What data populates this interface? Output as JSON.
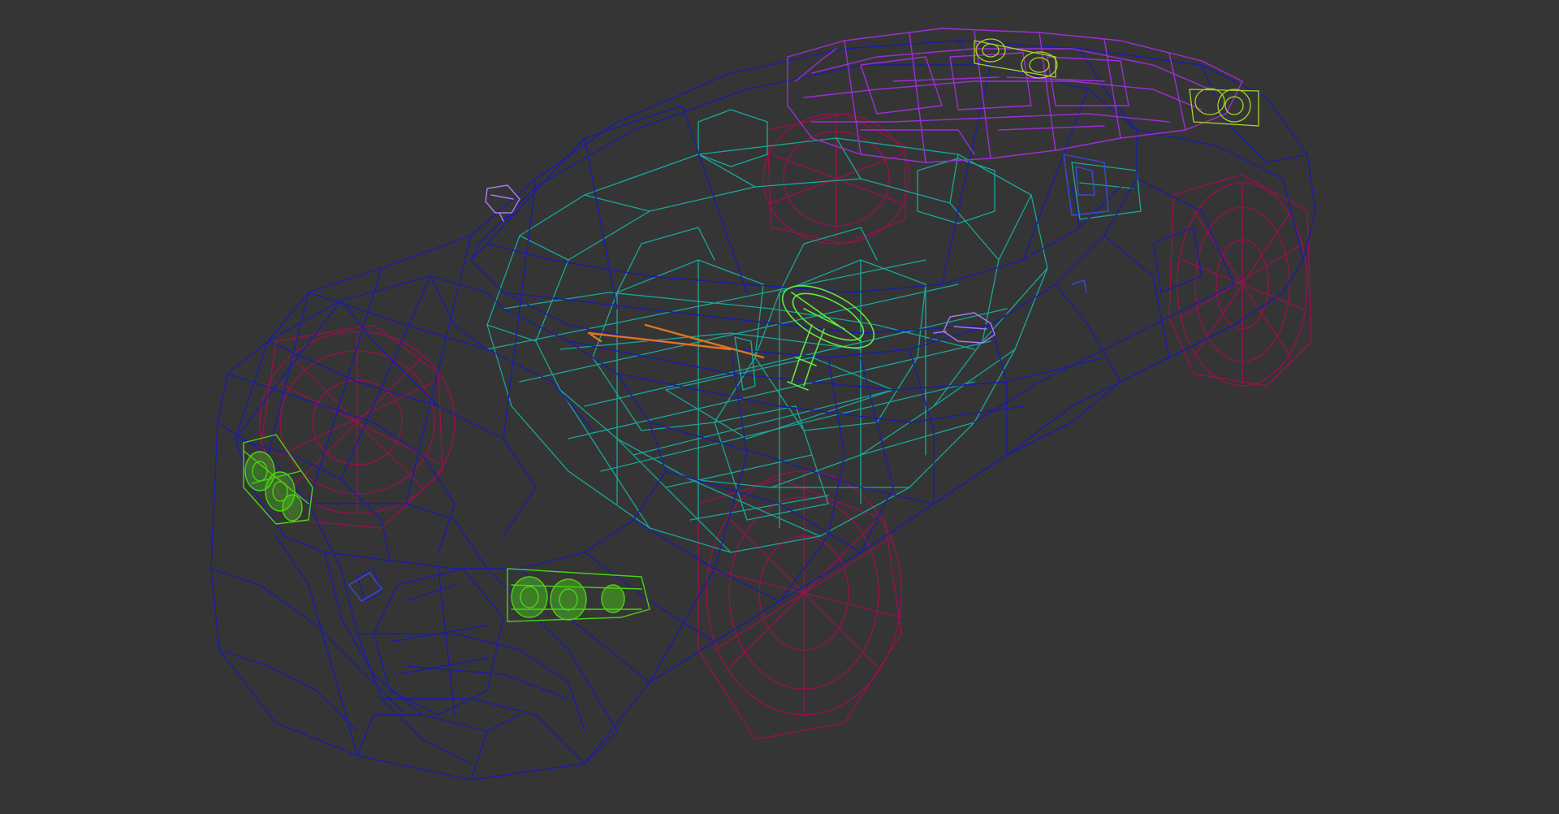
{
  "viewport": {
    "background": "#353535",
    "render_mode": "wireframe"
  },
  "model": {
    "subject": "sports car",
    "parts": [
      {
        "name": "body-shell",
        "color": "#1c1ca8"
      },
      {
        "name": "wheels",
        "color": "#9c0f4e"
      },
      {
        "name": "interior",
        "color": "#19a89a"
      },
      {
        "name": "rear-deck",
        "color": "#9c2fd6"
      },
      {
        "name": "head-lights",
        "color": "#4ad414"
      },
      {
        "name": "tail-lights",
        "color": "#a8d428"
      },
      {
        "name": "steering-wheel",
        "color": "#63e83c"
      },
      {
        "name": "side-mirrors",
        "color": "#a878ee"
      },
      {
        "name": "wiper",
        "color": "#e0761c"
      }
    ]
  }
}
